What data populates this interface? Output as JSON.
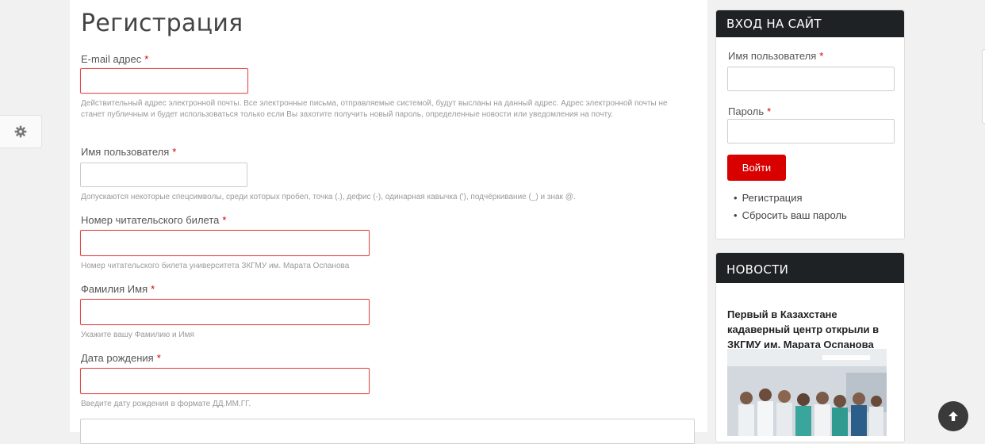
{
  "page": {
    "title": "Регистрация"
  },
  "form": {
    "required_mark": "*",
    "email": {
      "label": "E-mail адрес",
      "value": "",
      "help": "Действительный адрес электронной почты. Все электронные письма, отправляемые системой, будут высланы на данный адрес. Адрес электронной почты не станет публичным и будет использоваться только если Вы захотите получить новый пароль, определенные новости или уведомления на почту."
    },
    "username": {
      "label": "Имя пользователя",
      "value": "",
      "help": "Допускаются некоторые спецсимволы, среди которых пробел, точка (.), дефис (-), одинарная кавычка ('), подчёркивание (_) и знак @."
    },
    "ticket": {
      "label": "Номер читательского билета",
      "value": "",
      "help": "Номер читательского билета университета ЗКГМУ им. Марата Оспанова"
    },
    "fullname": {
      "label": "Фамилия Имя",
      "value": "",
      "help": "Укажите вашу Фамилию и Имя"
    },
    "birthdate": {
      "label": "Дата рождения",
      "value": "",
      "help": "Введите дату рождения в формате ДД.ММ.ГГ."
    }
  },
  "login_block": {
    "title": "ВХОД НА САЙТ",
    "username_label": "Имя пользователя",
    "password_label": "Пароль",
    "required_mark": "*",
    "login_button": "Войти",
    "links": [
      "Регистрация",
      "Сбросить ваш пароль"
    ]
  },
  "news_block": {
    "title": "НОВОСТИ",
    "item_title": "Первый в Казахстане кадаверный центр открыли в ЗКГМУ им. Марата Оспанова"
  },
  "icons": {
    "settings": "gear-icon",
    "scroll_top": "arrow-up-icon"
  },
  "colors": {
    "accent": "#d90000",
    "error_border": "#e24a4a",
    "block_header": "#1f2224"
  }
}
